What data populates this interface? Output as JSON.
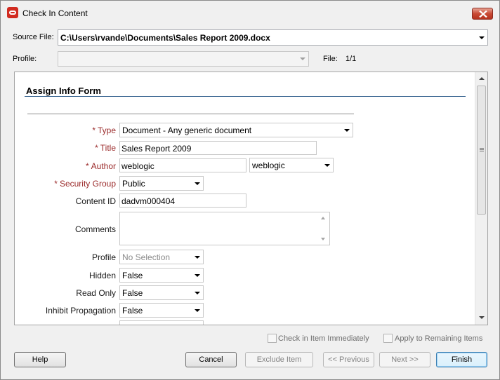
{
  "window": {
    "title": "Check In Content",
    "close_icon": "close-icon",
    "app_icon": "oracle-icon"
  },
  "source_file": {
    "label": "Source File:",
    "value": "C:\\Users\\rvande\\Documents\\Sales Report 2009.docx"
  },
  "profile": {
    "label": "Profile:",
    "value": ""
  },
  "file_counter": {
    "label": "File:",
    "value": "1/1"
  },
  "form": {
    "title": "Assign Info Form",
    "required_marker": "*",
    "fields": {
      "type": {
        "label": "Type",
        "value": "Document - Any generic document"
      },
      "title": {
        "label": "Title",
        "value": "Sales Report 2009"
      },
      "author": {
        "label": "Author",
        "value": "weblogic",
        "select_value": "weblogic"
      },
      "security_group": {
        "label": "Security Group",
        "value": "Public"
      },
      "content_id": {
        "label": "Content ID",
        "value": "dadvm000404"
      },
      "comments": {
        "label": "Comments",
        "value": ""
      },
      "profile": {
        "label": "Profile",
        "value": "No Selection"
      },
      "hidden": {
        "label": "Hidden",
        "value": "False"
      },
      "read_only": {
        "label": "Read Only",
        "value": "False"
      },
      "inhibit_propagation": {
        "label": "Inhibit Propagation",
        "value": "False"
      }
    }
  },
  "options": {
    "check_in_immediately": "Check in Item Immediately",
    "apply_to_remaining": "Apply to Remaining Items"
  },
  "buttons": {
    "help": "Help",
    "cancel": "Cancel",
    "exclude_item": "Exclude Item",
    "previous": "<< Previous",
    "next": "Next >>",
    "finish": "Finish"
  },
  "colors": {
    "required_label": "#9b2b2b",
    "close_button": "#c94a35",
    "finish_border": "#3c7fb1"
  }
}
